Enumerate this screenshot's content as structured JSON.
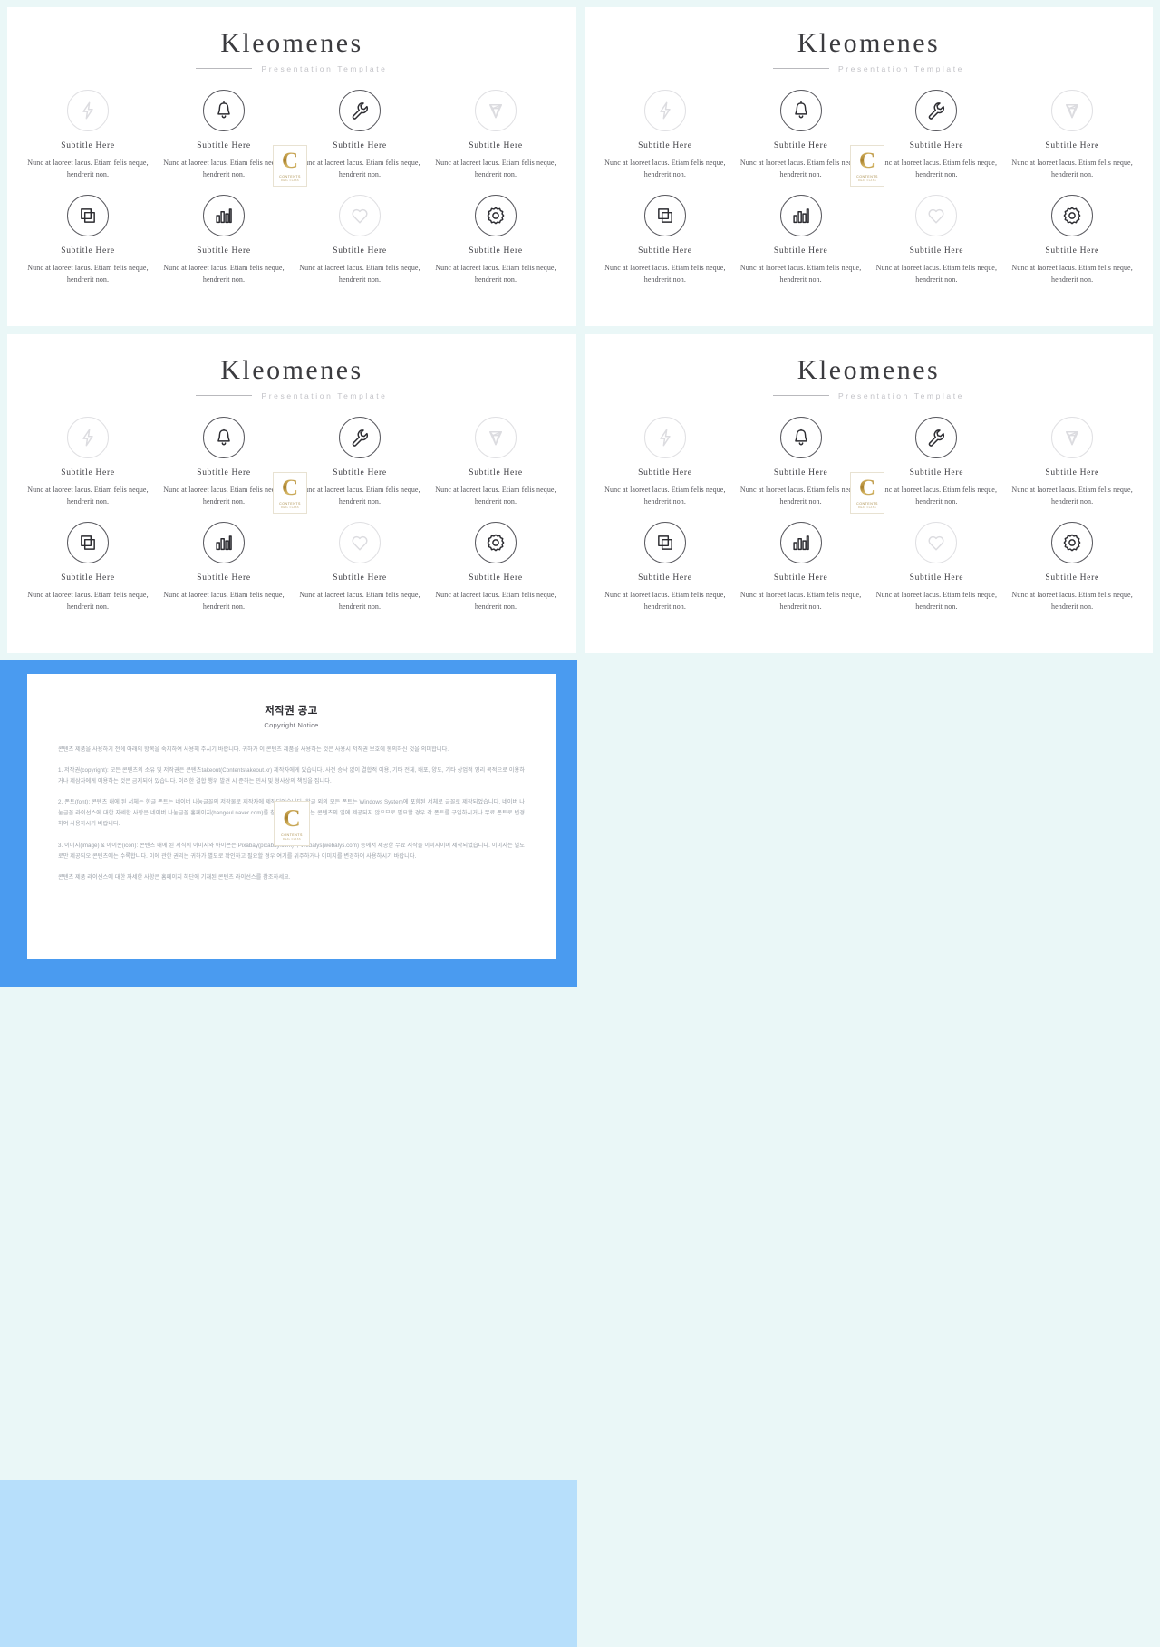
{
  "deck": {
    "title": "Kleomenes",
    "subtitle": "Presentation  Template"
  },
  "features": [
    {
      "icon": "lightning-bolt-icon",
      "style": "muted",
      "title": "Subtitle Here",
      "body": "Nunc at laoreet lacus. Etiam felis neque, hendrerit non."
    },
    {
      "icon": "bell-icon",
      "style": "dark",
      "title": "Subtitle Here",
      "body": "Nunc at laoreet lacus. Etiam felis neque, hendrerit non."
    },
    {
      "icon": "wrench-icon",
      "style": "dark",
      "title": "Subtitle Here",
      "body": "Nunc at laoreet lacus. Etiam felis neque, hendrerit non."
    },
    {
      "icon": "diamond-icon",
      "style": "muted",
      "title": "Subtitle Here",
      "body": "Nunc at laoreet lacus. Etiam felis neque, hendrerit non."
    },
    {
      "icon": "layers-icon",
      "style": "dark",
      "title": "Subtitle Here",
      "body": "Nunc at laoreet lacus. Etiam felis neque, hendrerit non."
    },
    {
      "icon": "bar-chart-icon",
      "style": "dark",
      "title": "Subtitle Here",
      "body": "Nunc at laoreet lacus. Etiam felis neque, hendrerit non."
    },
    {
      "icon": "heart-icon",
      "style": "muted",
      "title": "Subtitle Here",
      "body": "Nunc at laoreet lacus. Etiam felis neque, hendrerit non."
    },
    {
      "icon": "gear-icon",
      "style": "dark",
      "title": "Subtitle Here",
      "body": "Nunc at laoreet lacus. Etiam felis neque, hendrerit non."
    }
  ],
  "watermark": {
    "letter": "C",
    "name": "CONTENTS",
    "sub": "REAL  CLASS"
  },
  "notice": {
    "title": "저작권 공고",
    "subtitle": "Copyright Notice",
    "paragraphs": [
      "콘텐츠 제품을 사용하기 전에 아래의 항목을 숙지하여 사용해 주시기 바랍니다. 귀하가 이 콘텐츠 제품을 사용하는 것은 사용시 저작권 보호에 동의하신 것을 의미합니다.",
      "1. 저작권(copyright): 모든 콘텐츠의 소유 및 저작권은 콘텐츠takeout(Contentstakeout.kr) 제작자에게 있습니다. 사전 승낙 없이 결합적 이용, 기타 전체, 배포, 양도, 기타 상업적 영리 목적으로 이용하거나 제삼자에게 이용하는 것은 금지되어 있습니다. 이러한 결합 행위 발견 시 준하는 민사 및 형사상의 책임을 집니다.",
      "2. 폰트(font): 콘텐츠 내에 된 서체는 한글 폰트는 네이버 나눔글꼴의 저작물로 제작자에 제작되었습니다. 한글 외의 모든 폰트는 Windows System에 포함된 서체로 글꼴로 제작되었습니다. 네이버 나눔글꼴 라이선스에 대한 자세한 사항은 네이버 나눔글꼴 홈페이지(hangeul.naver.com)를 참조하세요. 폰트는 콘텐츠의 일에 제공되지 않으므로 필요할 경우 각 폰트를 구입하시거나 무료 폰트로 변경하여 사용하시기 바랍니다.",
      "3. 이미지(image) & 아이콘(icon): 콘텐츠 내에 된 서식의 이미지와 아이콘은 Pixabay(pixabay.com)와 Webalys(webalys.com) 등에서 제공한 무료 저작물 이미지이며 제작되었습니다. 이미지는 별도로만 제공되오 콘텐츠에는 수록합니다. 이에 관한 권리는 귀하가 별도로 확인하고 필요할 경우 여기를 위주하거나 이미지를 변경하여 사용하시기 바랍니다.",
      "콘텐츠 제품 라이선스에 대한 자세한 사항은 홈페이지 하단에 기재된 콘텐츠 라이선스를 참조하세요."
    ]
  }
}
